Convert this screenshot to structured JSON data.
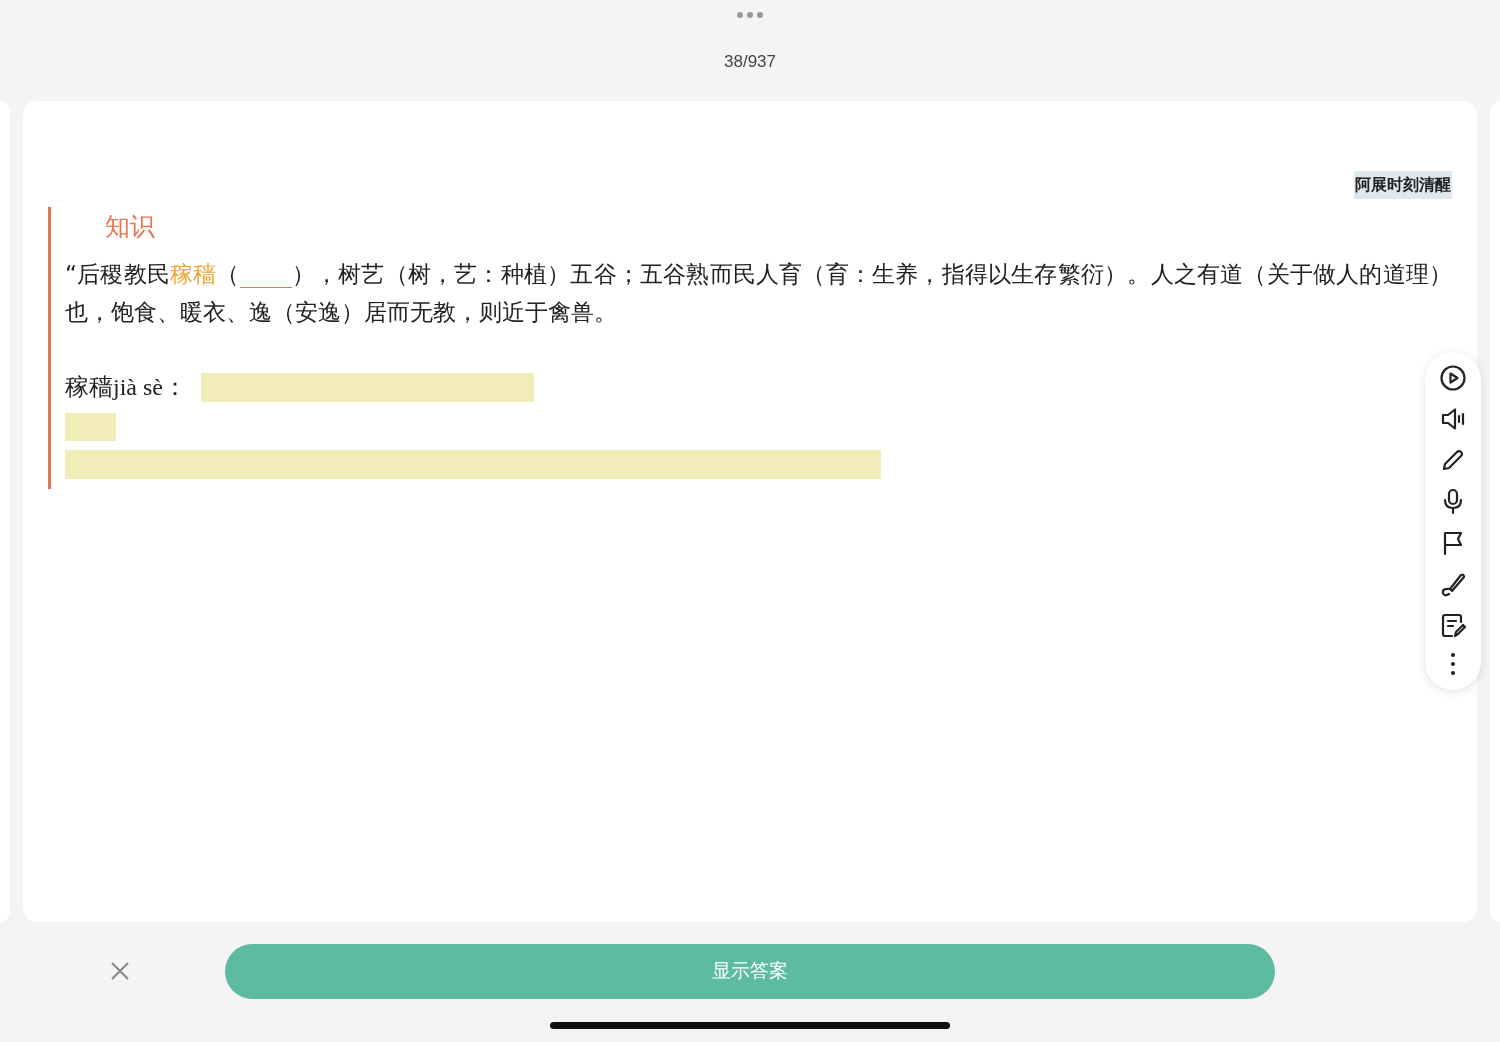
{
  "header": {
    "counter": "38/937"
  },
  "card": {
    "tag": "阿展时刻清醒",
    "section_title": "知识",
    "passage": [
      {
        "kind": "text",
        "text": "“后稷教民"
      },
      {
        "kind": "highlight",
        "text": "稼穑"
      },
      {
        "kind": "text",
        "text": "（"
      },
      {
        "kind": "blank"
      },
      {
        "kind": "text",
        "text": "），树艺（树，艺：种植）五谷；五谷熟而民人育（育：生养，指得以生存繁衍）。人之有道（关于做人的道理）也，饱食、暖衣、逸（安逸）居而无教，则近于禽兽。"
      }
    ],
    "answer_label": "稼穑jià sè：",
    "hidden_answers": [
      {
        "kind": "inline"
      },
      {
        "kind": "short"
      },
      {
        "kind": "long"
      }
    ]
  },
  "bottom": {
    "show_answer_button": "显示答案"
  }
}
